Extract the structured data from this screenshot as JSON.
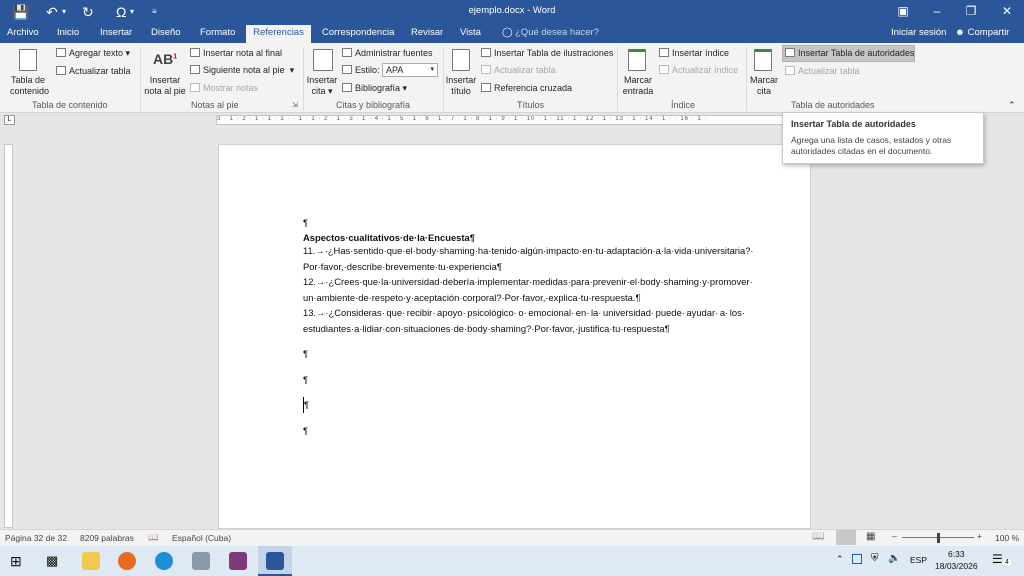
{
  "app": {
    "document_title": "ejemplo.docx  -  Word"
  },
  "tabs": [
    "Archivo",
    "Inicio",
    "Insertar",
    "Diseño",
    "Formato",
    "Referencias",
    "Correspondencia",
    "Revisar",
    "Vista"
  ],
  "tell_me": "¿Qué desea hacer?",
  "sign_in": "Iniciar sesión",
  "share": "Compartir",
  "ribbon": {
    "toc": {
      "btn_line1": "Tabla de",
      "btn_line2": "contenido",
      "add_text": "Agregar texto",
      "update_table": "Actualizar tabla",
      "group": "Tabla de contenido"
    },
    "footnotes": {
      "btn_line1": "Insertar",
      "btn_line2": "nota al pie",
      "insert_endnote": "Insertar nota al final",
      "next_footnote": "Siguiente nota al pie",
      "show_notes": "Mostrar notas",
      "group": "Notas al pie"
    },
    "citations": {
      "btn_line1": "Insertar",
      "btn_line2": "cita",
      "manage_sources": "Administrar fuentes",
      "style_label": "Estilo:",
      "style_value": "APA",
      "bibliography": "Bibliografía",
      "group": "Citas y bibliografía"
    },
    "captions": {
      "btn_line1": "Insertar",
      "btn_line2": "título",
      "insert_table_figures": "Insertar Tabla de ilustraciones",
      "update_table": "Actualizar tabla",
      "cross_reference": "Referencia cruzada",
      "group": "Títulos"
    },
    "index": {
      "btn_line1": "Marcar",
      "btn_line2": "entrada",
      "insert_index": "Insertar índice",
      "update_index": "Actualizar índice",
      "group": "Índice"
    },
    "authorities": {
      "btn_line1": "Marcar",
      "btn_line2": "cita",
      "insert_toa": "Insertar Tabla de autoridades",
      "update_table": "Actualizar tabla",
      "group": "Tabla de autoridades"
    }
  },
  "ruler_text": "3 · 1 · 2 · 1 · 1 · 1 ·   · 1 · 1 · 2 · 1 · 3 · 1 · 4 · 1 · 5 · 1 · 6 · 1 · 7 · 1 · 8 · 1 · 9 · 1 · 10 · 1 · 11 · 1 · 12 · 1 · 13 · 1 · 14 · 1 ·   · 16 · 1 ·",
  "document": {
    "lines": [
      "¶",
      "Aspectos·cualitativos·de·la·Encuesta¶",
      "11.→·¿Has·sentido·que·el·body·shaming·ha·tenido·algún·impacto·en·tu·adaptación·a·la·vida·universitaria?·",
      "Por·favor,·describe·brevemente·tu·experiencia¶",
      "12.→·¿Crees·que·la·universidad·debería·implementar·medidas·para·prevenir·el·body·shaming·y·promover·",
      "un·ambiente·de·respeto·y·aceptación·corporal?·Por·favor,·explica·tu·respuesta.¶",
      "13.→·¿Consideras·  que·  recibir·  apoyo·  psicológico·  o·  emocional·  en·  la·  universidad·  puede·  ayudar·  a·  los·",
      "estudiantes·a·lidiar·con·situaciones·de·body·shaming?·Por·favor,·justifica·tu·respuesta¶",
      "¶",
      "¶",
      "¶",
      "¶"
    ]
  },
  "tooltip": {
    "title": "Insertar Tabla de autoridades",
    "desc_line1": "Agrega una lista de casos, estados y otras",
    "desc_line2": "autoridades citadas en el documento."
  },
  "status": {
    "page": "Página 32 de 32",
    "words": "8209 palabras",
    "language": "Español (Cuba)",
    "zoom": "100 %",
    "zoom_level": 1.0
  },
  "taskbar": {
    "lang": "ESP",
    "time": "6:33",
    "date": "18/03/2026",
    "notif_count": "4"
  },
  "colors": {
    "word_blue": "#2b579a",
    "ribbon_bg": "#f3f3f3",
    "taskbar_bg": "#dee9f4"
  }
}
